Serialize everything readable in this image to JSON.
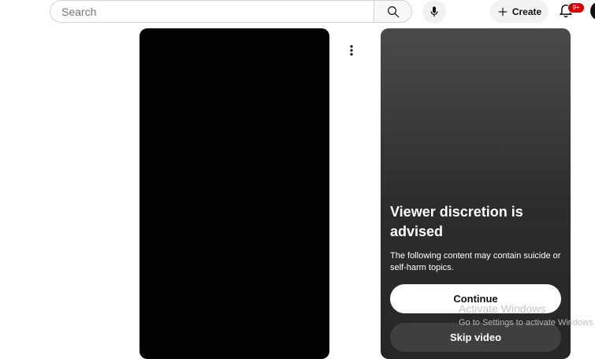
{
  "header": {
    "search": {
      "placeholder": "Search",
      "value": ""
    },
    "search_icon": "search-icon",
    "mic_icon": "microphone-icon",
    "create_label": "Create",
    "notifications_badge": "9+"
  },
  "video": {
    "more_icon": "more-vertical-icon"
  },
  "warning": {
    "title": "Viewer discretion is advised",
    "text": "The following content may contain suicide or self-harm topics.",
    "continue_label": "Continue",
    "skip_label": "Skip video"
  },
  "watermark": {
    "title": "Activate Windows",
    "subtitle": "Go to Settings to activate Windows."
  }
}
